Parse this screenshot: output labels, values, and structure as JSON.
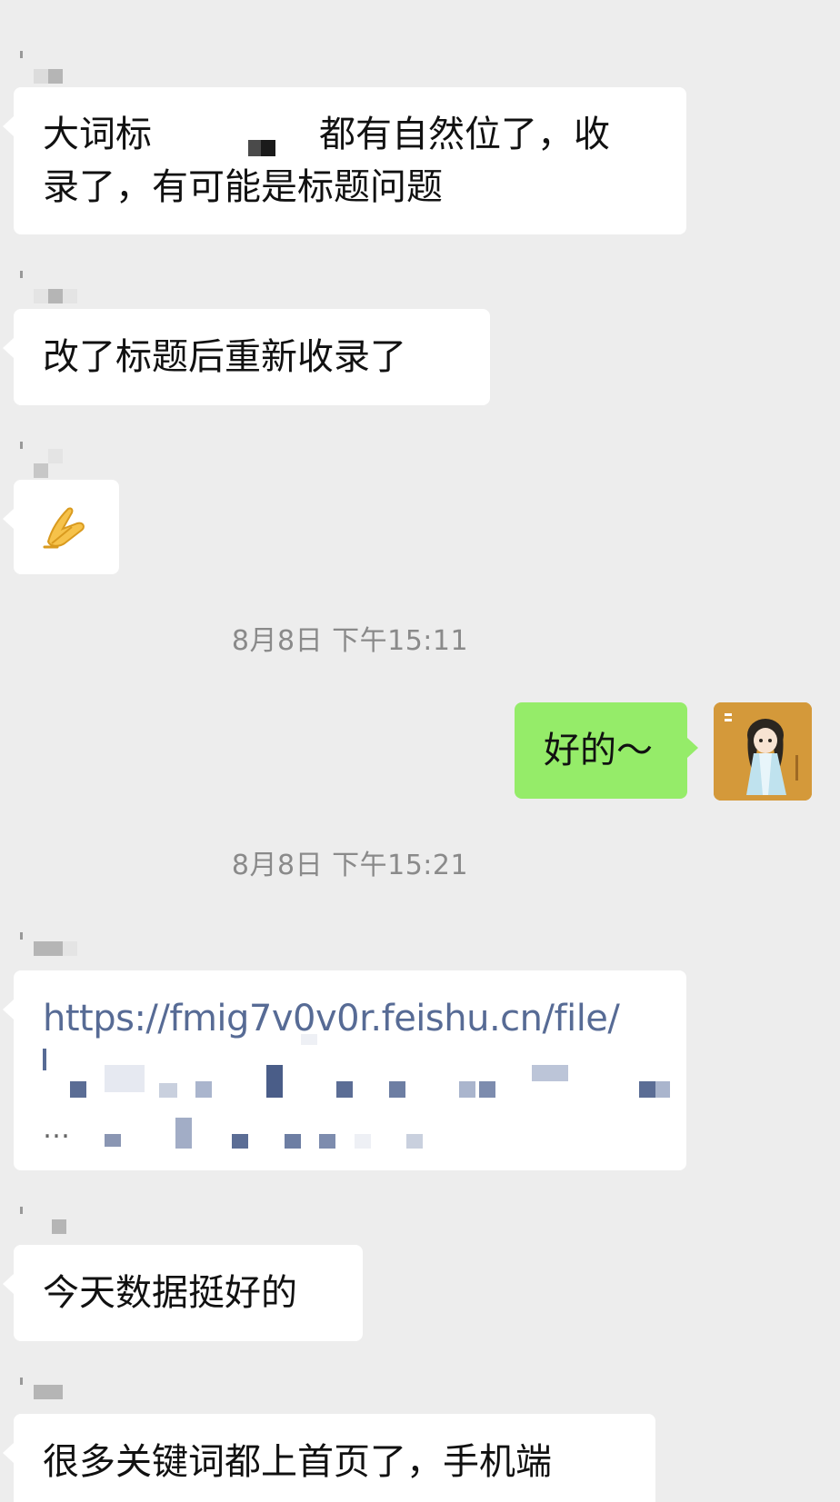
{
  "messages": [
    {
      "side": "left",
      "lines": [
        "大词标",
        "都有自然位了，收",
        "录了，有可能是标题问题"
      ]
    },
    {
      "side": "left",
      "text": "改了标题后重新收录了"
    },
    {
      "side": "left",
      "emoji": "🙏",
      "emoji_name": "pray-emoji"
    },
    {
      "side": "right",
      "text": "好的～"
    },
    {
      "side": "left",
      "link": "https://fmig7v0v0r.feishu.cn/file/",
      "link_ellipsis": "…"
    },
    {
      "side": "left",
      "text": "今天数据挺好的"
    },
    {
      "side": "left",
      "text": "很多关键词都上首页了，手机端"
    }
  ],
  "timestamps": [
    "8月8日 下午15:11",
    "8月8日 下午15:21"
  ],
  "avatar": {
    "name": "user-avatar",
    "bg": "#d39a3c"
  },
  "colors": {
    "background": "#ededed",
    "bubble_in": "#ffffff",
    "bubble_out": "#95ec69",
    "link": "#576b95",
    "timestamp": "#8a8a8a"
  }
}
